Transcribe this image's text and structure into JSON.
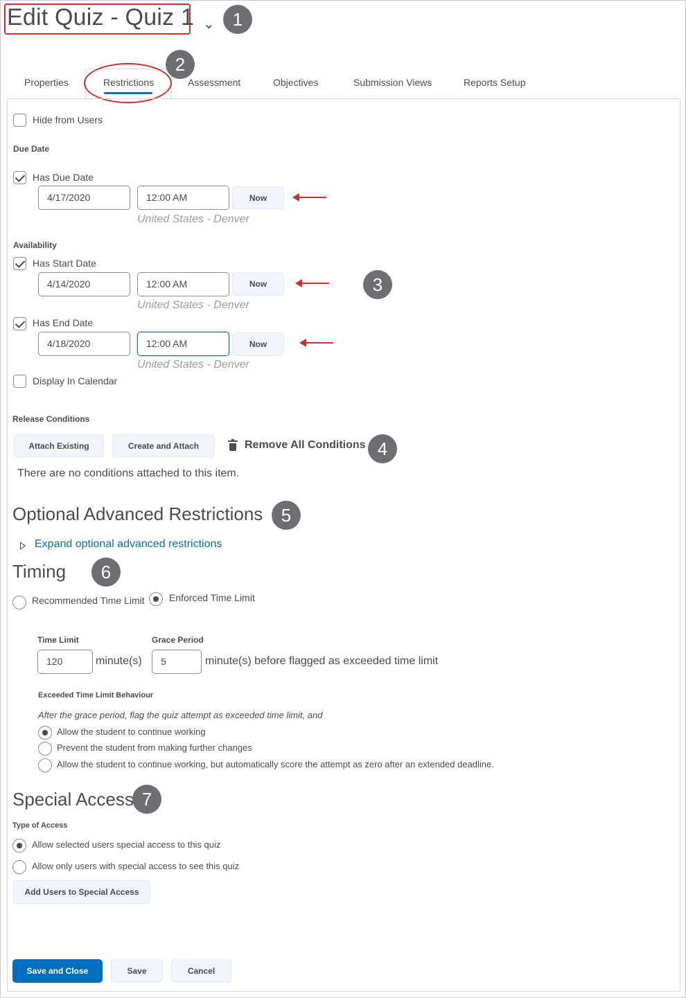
{
  "header": {
    "title": "Edit Quiz - Quiz 1",
    "chevron": "⌄"
  },
  "callouts": [
    "1",
    "2",
    "3",
    "4",
    "5",
    "6",
    "7"
  ],
  "tabs": [
    {
      "label": "Properties"
    },
    {
      "label": "Restrictions",
      "active": true
    },
    {
      "label": "Assessment"
    },
    {
      "label": "Objectives"
    },
    {
      "label": "Submission Views"
    },
    {
      "label": "Reports Setup"
    }
  ],
  "restrictions": {
    "hide_from_users": {
      "label": "Hide from Users",
      "checked": false
    },
    "due_date": {
      "heading": "Due Date",
      "has_label": "Has Due Date",
      "checked": true,
      "date": "4/17/2020",
      "time": "12:00 AM",
      "now": "Now",
      "timezone": "United States - Denver"
    },
    "availability": {
      "heading": "Availability",
      "start": {
        "has_label": "Has Start Date",
        "checked": true,
        "date": "4/14/2020",
        "time": "12:00 AM",
        "now": "Now",
        "timezone": "United States - Denver"
      },
      "end": {
        "has_label": "Has End Date",
        "checked": true,
        "date": "4/18/2020",
        "time": "12:00 AM",
        "now": "Now",
        "timezone": "United States - Denver"
      },
      "display_in_calendar": {
        "label": "Display In Calendar",
        "checked": false
      }
    }
  },
  "release_conditions": {
    "heading": "Release Conditions",
    "attach_existing": "Attach Existing",
    "create_and_attach": "Create and Attach",
    "remove_all": "Remove All Conditions",
    "empty_text": "There are no conditions attached to this item."
  },
  "optional_advanced": {
    "heading": "Optional Advanced Restrictions",
    "expand_link": "Expand optional advanced restrictions"
  },
  "timing": {
    "heading": "Timing",
    "recommended": "Recommended Time Limit",
    "enforced": "Enforced Time Limit",
    "selected": "enforced",
    "time_limit_label": "Time Limit",
    "time_limit_value": "120",
    "time_limit_unit": "minute(s)",
    "grace_label": "Grace Period",
    "grace_value": "5",
    "grace_unit": "minute(s) before flagged as exceeded time limit",
    "exceeded_heading": "Exceeded Time Limit Behaviour",
    "exceeded_intro": "After the grace period, flag the quiz attempt as exceeded time limit, and",
    "options": [
      {
        "label": "Allow the student to continue working",
        "selected": true
      },
      {
        "label": "Prevent the student from making further changes",
        "selected": false
      },
      {
        "label": "Allow the student to continue working, but automatically score the attempt as zero after an extended deadline.",
        "selected": false
      }
    ]
  },
  "special_access": {
    "heading": "Special Access",
    "type_label": "Type of Access",
    "options": [
      {
        "label": "Allow selected users special access to this quiz",
        "selected": true
      },
      {
        "label": "Allow only users with special access to see this quiz",
        "selected": false
      }
    ],
    "add_button": "Add Users to Special Access"
  },
  "footer": {
    "save_and_close": "Save and Close",
    "save": "Save",
    "cancel": "Cancel"
  },
  "colors": {
    "primary": "#006fbf",
    "annotation": "#d62b2b",
    "badge": "#6d6e71",
    "text": "#494c4e"
  }
}
